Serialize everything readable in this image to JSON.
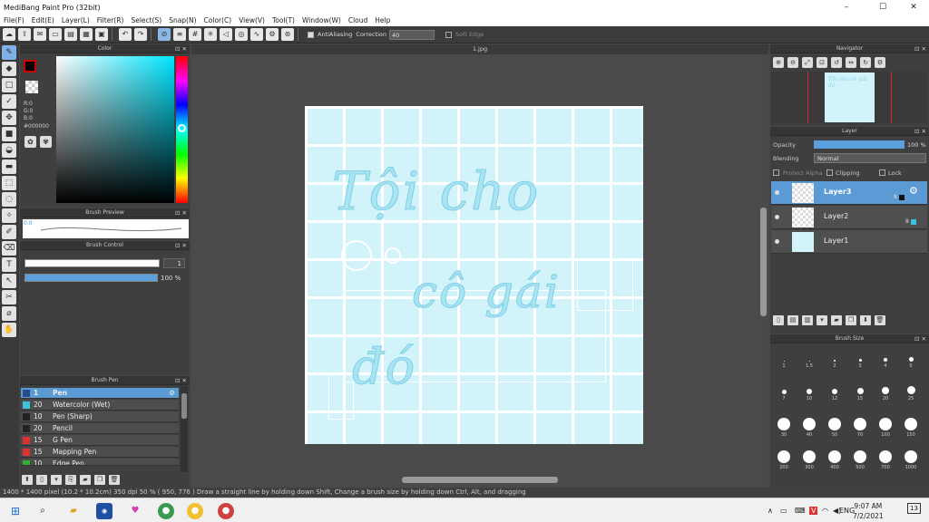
{
  "window": {
    "title": "MediBang Paint Pro (32bit)",
    "controls": [
      "–",
      "☐",
      "✕"
    ]
  },
  "menu": [
    "File(F)",
    "Edit(E)",
    "Layer(L)",
    "Filter(R)",
    "Select(S)",
    "Snap(N)",
    "Color(C)",
    "View(V)",
    "Tool(T)",
    "Window(W)",
    "Cloud",
    "Help"
  ],
  "toolbar": {
    "antialias_label": "AntiAliasing",
    "correction_label": "Correction",
    "correction_value": "40",
    "softedge_label": "Soft Edge"
  },
  "color_panel": {
    "title": "Color",
    "r": "R:0",
    "g": "G:0",
    "b": "B:0",
    "hex": "#000000",
    "fg_color": "#000000",
    "bg_color": "#ffff00"
  },
  "brush_preview": {
    "title": "Brush Preview",
    "value": "0.0"
  },
  "brush_control": {
    "title": "Brush Control",
    "size": "1",
    "opacity": "100 %"
  },
  "brush_list": {
    "title": "Brush Pen",
    "items": [
      {
        "size": "1",
        "name": "Pen",
        "color": "#2a4a8a",
        "selected": true
      },
      {
        "size": "20",
        "name": "Watercolor (Wet)",
        "color": "#3fc1e0",
        "selected": false
      },
      {
        "size": "10",
        "name": "Pen (Sharp)",
        "color": "#222222",
        "selected": false
      },
      {
        "size": "20",
        "name": "Pencil",
        "color": "#222222",
        "selected": false
      },
      {
        "size": "15",
        "name": "G Pen",
        "color": "#e03030",
        "selected": false
      },
      {
        "size": "15",
        "name": "Mapping Pen",
        "color": "#e03030",
        "selected": false
      },
      {
        "size": "10",
        "name": "Edge Pen",
        "color": "#30b030",
        "selected": false
      }
    ]
  },
  "canvas": {
    "tab": "1.jpg",
    "text_line1": "Tội cho",
    "text_line2": "cô gái",
    "text_line3": "đó"
  },
  "navigator": {
    "title": "Navigator",
    "thumb_text": "Tội cho cô gái đó"
  },
  "layer_panel": {
    "title": "Layer",
    "opacity_label": "Opacity",
    "opacity_value": "100 %",
    "blending_label": "Blending",
    "blending_value": "Normal",
    "protect_alpha": "Protect Alpha",
    "clipping": "Clipping",
    "lock": "Lock",
    "layers": [
      {
        "name": "Layer3",
        "selected": true,
        "thumb": "transparent",
        "badge": "8"
      },
      {
        "name": "Layer2",
        "selected": false,
        "thumb": "transparent",
        "badge": "8"
      },
      {
        "name": "Layer1",
        "selected": false,
        "thumb": "blue",
        "badge": ""
      }
    ]
  },
  "brush_size": {
    "title": "Brush Size",
    "sizes": [
      "1",
      "1.5",
      "2",
      "3",
      "4",
      "5",
      "7",
      "10",
      "12",
      "15",
      "20",
      "25",
      "30",
      "40",
      "50",
      "70",
      "100",
      "150",
      "200",
      "300",
      "400",
      "500",
      "700",
      "1000"
    ]
  },
  "status": {
    "text": "1400 * 1400 pixel   (10.2 * 10.2cm)   350 dpi   50 %   ( 950, 776 )   Draw a straight line by holding down Shift, Change a brush size by holding down Ctrl, Alt, and dragging"
  },
  "taskbar": {
    "lang": "ENG",
    "time": "9:07 AM",
    "date": "7/2/2021",
    "notifications": "13"
  }
}
